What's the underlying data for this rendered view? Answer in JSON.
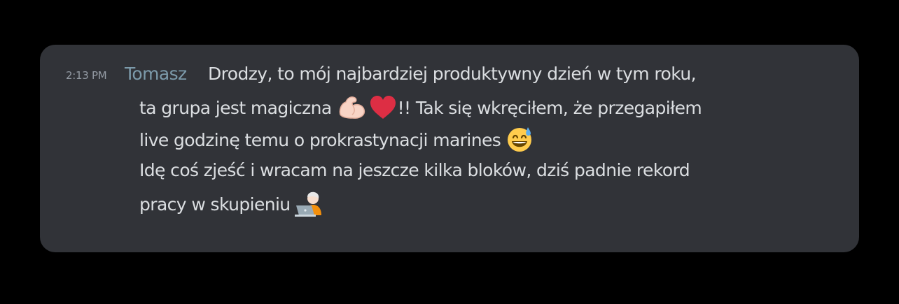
{
  "message": {
    "timestamp": "2:13 PM",
    "author": "Tomasz",
    "line1": "Drodzy, to mój najbardziej produktywny dzień w tym roku,",
    "line2_before": "ta grupa jest magiczna",
    "line2_after": "!! Tak się wkręciłem, że przegapiłem",
    "line3": "live godzinę temu o prokrastynacji marines",
    "line4": "Idę coś zjeść i wracam na jeszcze kilka bloków, dziś padnie rekord",
    "line5": "pracy w skupieniu"
  },
  "emojis": [
    "flexed-biceps-icon",
    "red-heart-icon",
    "grinning-sweat-icon",
    "technologist-icon"
  ],
  "colors": {
    "background": "#000000",
    "card": "#313338",
    "text": "#dbdee1",
    "author": "#7c9aaa",
    "timestamp": "#949ba4"
  }
}
